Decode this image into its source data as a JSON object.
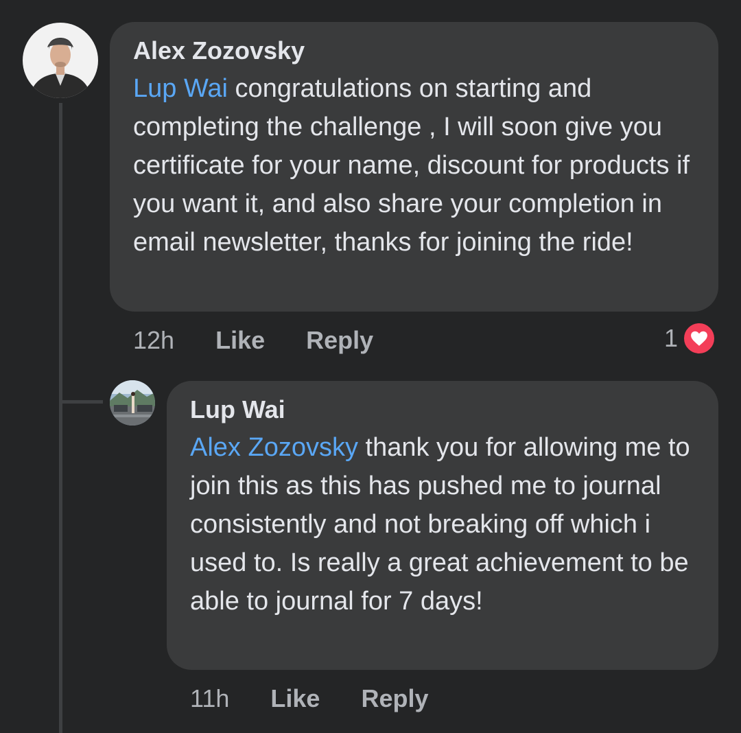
{
  "colors": {
    "background": "#242526",
    "bubble": "#3a3b3c",
    "text": "#e4e6eb",
    "secondary_text": "#b0b3b8",
    "mention": "#5aa7f5",
    "love_reaction": "#f33e58"
  },
  "comments": [
    {
      "author": "Alex Zozovsky",
      "mention": "Lup Wai",
      "text": " congratulations on starting and completing the challenge , I will soon give you certificate for your name, discount for products if you want it, and also share your completion in email newsletter, thanks for joining the ride!",
      "time": "12h",
      "like_label": "Like",
      "reply_label": "Reply",
      "reaction_count": "1",
      "reaction_icon": "heart-icon"
    },
    {
      "author": "Lup Wai",
      "mention": "Alex Zozovsky",
      "text": " thank you for allowing me to join this as this has pushed me to journal consistently and not breaking off which i used to. Is really a great achievement to be able to journal for 7 days!",
      "time": "11h",
      "like_label": "Like",
      "reply_label": "Reply"
    }
  ]
}
